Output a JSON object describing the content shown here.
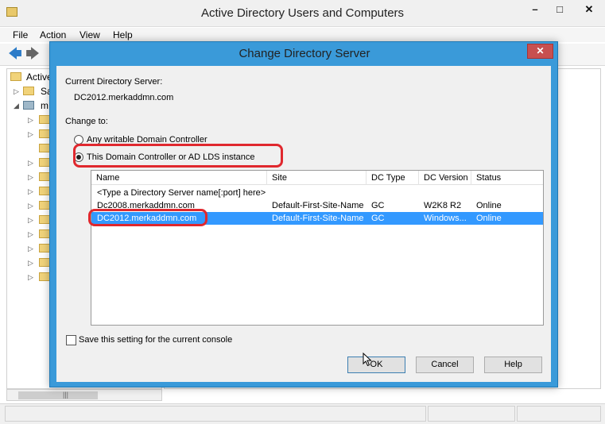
{
  "window": {
    "title": "Active Directory Users and Computers",
    "min_glyph": "–",
    "max_glyph": "□",
    "close_glyph": "✕"
  },
  "menu": [
    "File",
    "Action",
    "View",
    "Help"
  ],
  "toolbar": {
    "back_glyph": "🡄",
    "forward_glyph": "🡆"
  },
  "tree": {
    "root_label": "Active",
    "items": [
      {
        "label": "Sa"
      },
      {
        "label": "m"
      }
    ],
    "scroll_grip": "|||"
  },
  "dialog": {
    "title": "Change Directory Server",
    "close_glyph": "✕",
    "current_server_label": "Current Directory Server:",
    "current_server_value": "DC2012.merkaddmn.com",
    "change_to_label": "Change to:",
    "radio_any": "Any writable Domain Controller",
    "radio_this": "This Domain Controller or AD LDS instance",
    "columns": [
      "Name",
      "Site",
      "DC Type",
      "DC Version",
      "Status"
    ],
    "rows": [
      {
        "name": "<Type a Directory Server name[:port] here>",
        "site": "",
        "dc_type": "",
        "dc_version": "",
        "status": ""
      },
      {
        "name": "Dc2008.merkaddmn.com",
        "site": "Default-First-Site-Name",
        "dc_type": "GC",
        "dc_version": "W2K8 R2",
        "status": "Online"
      },
      {
        "name": "DC2012.merkaddmn.com",
        "site": "Default-First-Site-Name",
        "dc_type": "GC",
        "dc_version": "Windows...",
        "status": "Online"
      }
    ],
    "save_setting_label": "Save this setting for the current console",
    "ok_label": "OK",
    "cancel_label": "Cancel",
    "help_label": "Help"
  },
  "colors": {
    "dialog_frame": "#3a9ad9",
    "selection": "#3399ff",
    "highlight_annotation": "#e0282e"
  }
}
